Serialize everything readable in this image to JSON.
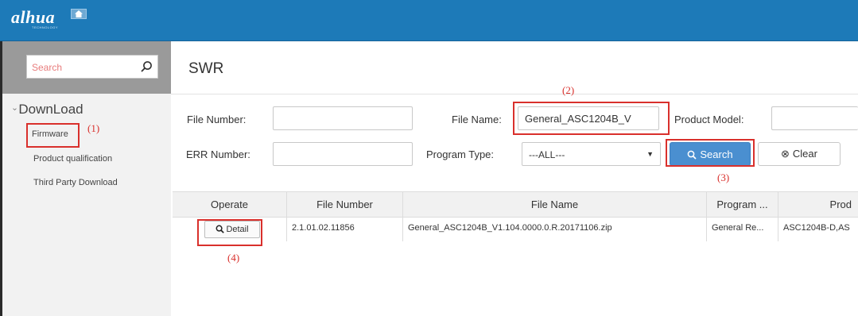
{
  "header": {
    "logo": "alhua",
    "logo_subtext": "TECHNOLOGY",
    "home_icon": "home-icon",
    "accent_color": "#1d7ab8"
  },
  "sidebar": {
    "search": {
      "placeholder": "Search",
      "icon": "search-icon"
    },
    "root": {
      "chevron": "›",
      "label": "DownLoad"
    },
    "items": [
      {
        "label": "Firmware"
      },
      {
        "label": "Product qualification"
      },
      {
        "label": "Third Party Download"
      }
    ]
  },
  "main": {
    "title": "SWR",
    "form": {
      "file_number": {
        "label": "File Number:",
        "value": ""
      },
      "file_name": {
        "label": "File Name:",
        "value": "General_ASC1204B_V"
      },
      "product_model": {
        "label": "Product Model:",
        "value": ""
      },
      "err_number": {
        "label": "ERR Number:",
        "value": ""
      },
      "program_type": {
        "label": "Program Type:",
        "value": "---ALL---",
        "caret": "▼"
      },
      "search_button": "Search",
      "clear_button": "Clear",
      "clear_icon": "⊗"
    },
    "grid": {
      "columns": [
        "Operate",
        "File Number",
        "File Name",
        "Program ...",
        "Prod"
      ],
      "rows": [
        {
          "operate": "Detail",
          "file_number": "2.1.01.02.11856",
          "file_name": "General_ASC1204B_V1.104.0000.0.R.20171106.zip",
          "program": "General Re...",
          "product": "ASC1204B-D,AS"
        }
      ]
    }
  },
  "annotations": {
    "note1": "(1)",
    "note2": "(2)",
    "note3": "(3)",
    "note4": "(4)",
    "color": "#d9302c"
  }
}
